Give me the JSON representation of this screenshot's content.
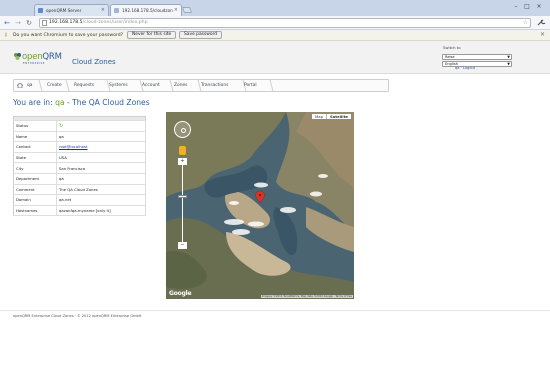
{
  "browser": {
    "tabs": [
      {
        "title": "openQRM Server",
        "active": false
      },
      {
        "title": "192.168.178.5/cloudzon",
        "active": true
      }
    ],
    "url_host": "192.168.178.5",
    "url_path": "/cloud-zones/user/index.php",
    "infobar": {
      "message": "Do you want Chromium to save your password?",
      "never_label": "Never for this site",
      "save_label": "Save password"
    }
  },
  "header": {
    "logo_open": "open",
    "logo_qrm": "QRM",
    "logo_sub": "ENTERPRISE",
    "app_title": "Cloud Zones",
    "switch_label": "Switch to",
    "switch_selects": [
      "Reise",
      "English"
    ],
    "user_links": "qa · Logout"
  },
  "nav": {
    "home_label": "qa",
    "items": [
      "Create",
      "Requests",
      "Systems",
      "Account",
      "Zones",
      "Transactions",
      "Portal"
    ]
  },
  "page": {
    "heading_prefix": "You are in:",
    "zone_name": "qa",
    "heading_suffix": " - The QA Cloud Zones"
  },
  "zone_details": {
    "status_icon": "↻",
    "rows": [
      {
        "label": "Status",
        "value": ""
      },
      {
        "label": "Name",
        "value": "qa"
      },
      {
        "label": "Contact",
        "value": "root@localhost"
      },
      {
        "label": "State",
        "value": "USA"
      },
      {
        "label": "City",
        "value": "San Francisco"
      },
      {
        "label": "Department",
        "value": "qa"
      },
      {
        "label": "Comment",
        "value": "The QA Cloud Zones"
      },
      {
        "label": "Domain",
        "value": "qa.net"
      },
      {
        "label": "Hostnames",
        "value": "qazonfqa-myname [only it]"
      }
    ]
  },
  "map": {
    "type_map": "Map",
    "type_satellite": "Satellite",
    "provider": "Google",
    "attribution": "Imagery ©2012 TerraMetrics, Map data ©2012 Google · Terms of Use"
  },
  "footer": {
    "text": "openQRM Enterprise Cloud Zones  ·  © 2012 openQRM Enterprise GmbH"
  },
  "colors": {
    "brand_blue": "#2a5fa0",
    "brand_green": "#6a9e2a",
    "link": "#2230b0"
  }
}
